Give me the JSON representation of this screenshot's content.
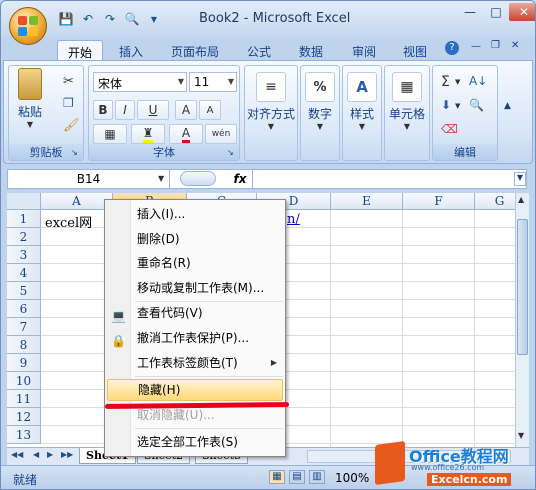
{
  "window": {
    "title": "Book2 - Microsoft Excel"
  },
  "ribbon_tabs": [
    "开始",
    "插入",
    "页面布局",
    "公式",
    "数据",
    "审阅",
    "视图"
  ],
  "clipboard": {
    "paste": "粘贴",
    "group": "剪贴板"
  },
  "font": {
    "name": "宋体",
    "size": "11",
    "group": "字体",
    "bold": "B",
    "italic": "I",
    "underline": "U",
    "grow": "A",
    "shrink": "A",
    "color_a": "A",
    "wen": "wén"
  },
  "align": {
    "label": "对齐方式"
  },
  "number": {
    "label": "数字",
    "symbol": "%"
  },
  "styles": {
    "label": "样式"
  },
  "cells": {
    "label": "单元格"
  },
  "editing": {
    "group": "编辑",
    "sum": "Σ"
  },
  "formula_bar": {
    "name_box": "B14",
    "fx": "fx"
  },
  "columns": [
    "A",
    "B",
    "C",
    "D",
    "E",
    "F",
    "G"
  ],
  "rows": [
    "1",
    "2",
    "3",
    "4",
    "5",
    "6",
    "7",
    "8",
    "9",
    "10",
    "11",
    "12",
    "13"
  ],
  "cells_data": {
    "a1": "excel网",
    "d1": "n/"
  },
  "context_menu": {
    "items": [
      {
        "label": "插入(I)..."
      },
      {
        "label": "删除(D)"
      },
      {
        "label": "重命名(R)"
      },
      {
        "label": "移动或复制工作表(M)..."
      },
      {
        "label": "查看代码(V)"
      },
      {
        "label": "撤消工作表保护(P)..."
      },
      {
        "label": "工作表标签颜色(T)"
      },
      {
        "label": "隐藏(H)"
      },
      {
        "label": "取消隐藏(U)..."
      },
      {
        "label": "选定全部工作表(S)"
      }
    ]
  },
  "sheets": [
    "Sheet1",
    "Sheet2",
    "Sheet3"
  ],
  "status": {
    "ready": "就绪",
    "zoom": "100%"
  },
  "watermark": {
    "brand": "Office教程网",
    "url": "www.office26.com",
    "sub": "Excelcn.com"
  },
  "colors": {
    "accent": "#15428b",
    "highlight": "#ffd97a",
    "underline_mark": "#e8001c"
  }
}
